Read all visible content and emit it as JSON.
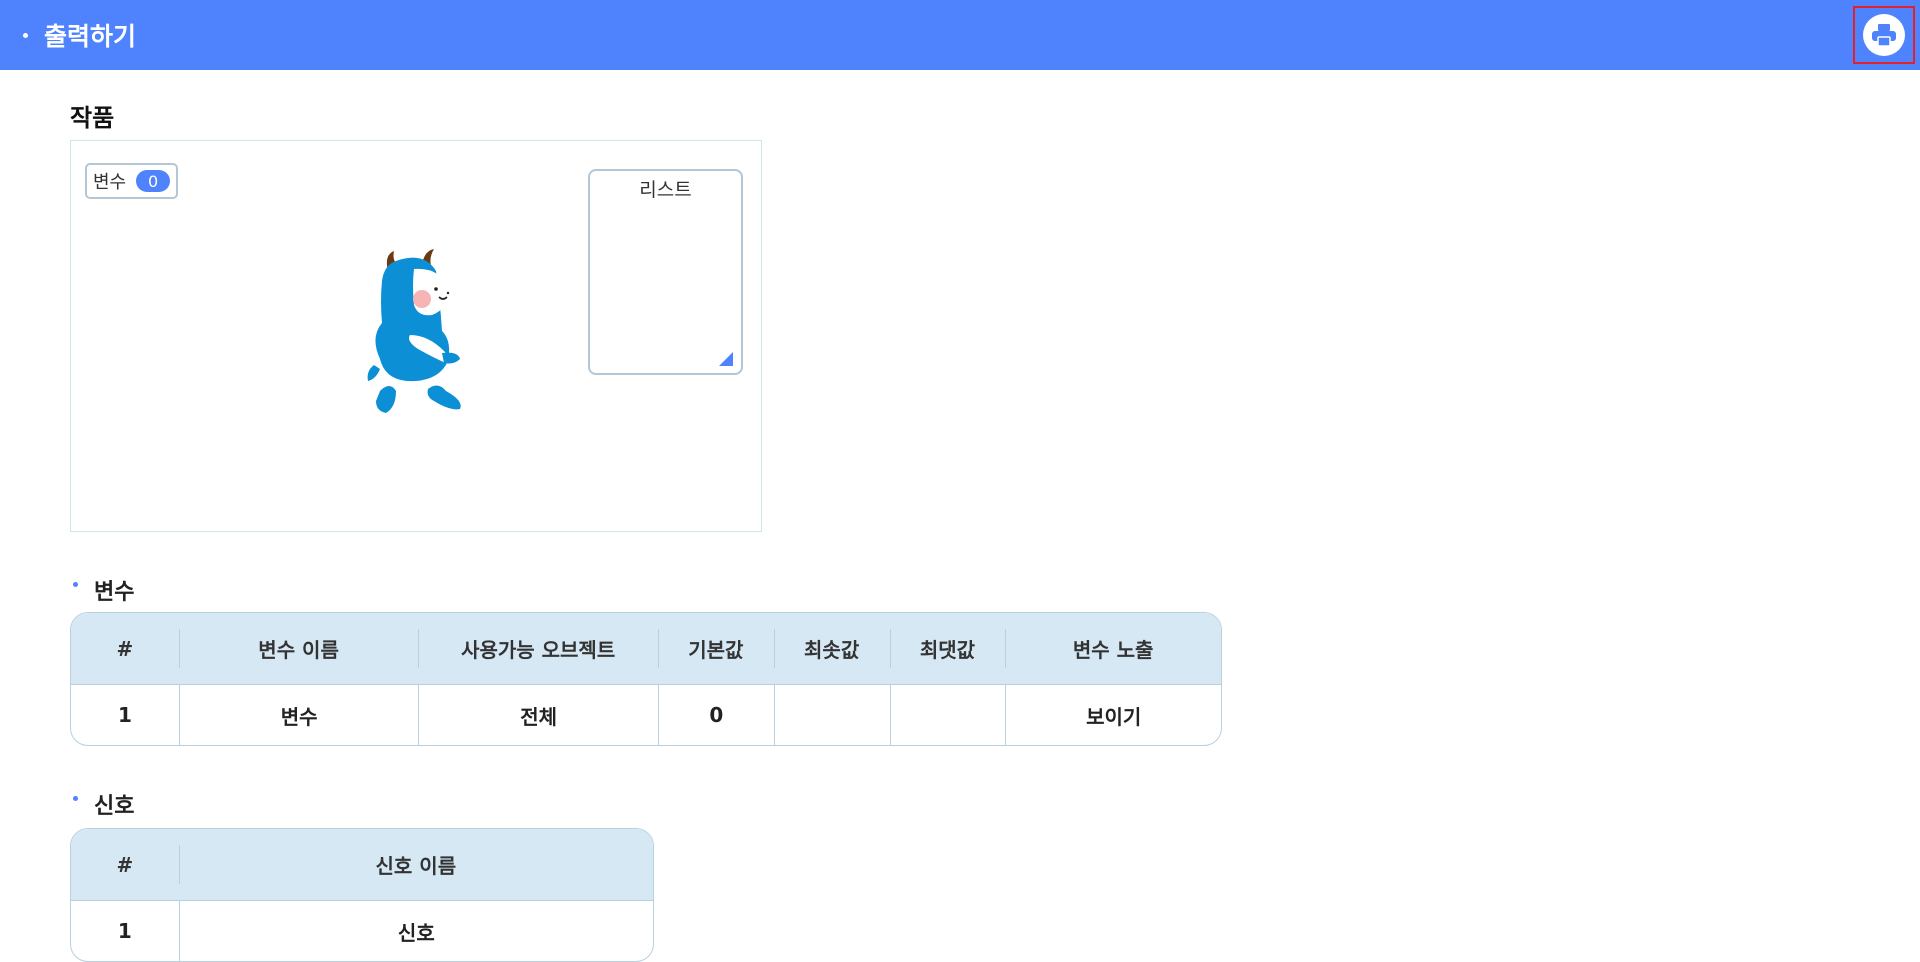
{
  "header": {
    "title": "출력하기",
    "print_icon": "printer-icon"
  },
  "work": {
    "title": "작품",
    "variable_monitor": {
      "label": "변수",
      "value": "0"
    },
    "list_monitor": {
      "title": "리스트"
    }
  },
  "variables": {
    "title": "변수",
    "columns": [
      "#",
      "변수 이름",
      "사용가능 오브젝트",
      "기본값",
      "최솟값",
      "최댓값",
      "변수 노출"
    ],
    "rows": [
      [
        "1",
        "변수",
        "전체",
        "0",
        "",
        "",
        "보이기"
      ]
    ]
  },
  "signals": {
    "title": "신호",
    "columns": [
      "#",
      "신호 이름"
    ],
    "rows": [
      [
        "1",
        "신호"
      ]
    ]
  },
  "colors": {
    "header_bg": "#4f82fd",
    "table_header_bg": "#d7e8f5",
    "highlight_border": "#e3212b"
  }
}
